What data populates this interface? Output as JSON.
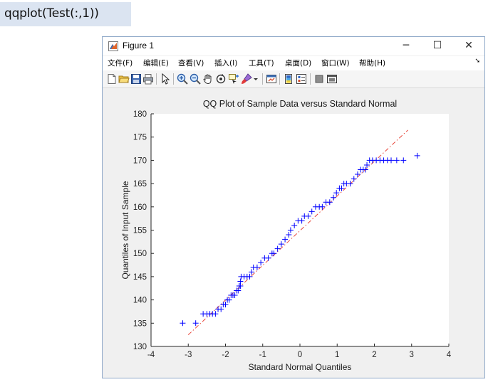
{
  "command": {
    "text": "qqplot(Test(:,1))"
  },
  "window": {
    "title": "Figure 1",
    "controls": {
      "minimize": "─",
      "maximize": "☐",
      "close": "✕"
    }
  },
  "menu": {
    "items": [
      "文件(F)",
      "编辑(E)",
      "查看(V)",
      "插入(I)",
      "工具(T)",
      "桌面(D)",
      "窗口(W)",
      "帮助(H)"
    ],
    "overflow_arrow": "➘"
  },
  "toolbar": {
    "icons": [
      "new-figure-icon",
      "open-file-icon",
      "save-icon",
      "print-icon",
      "edit-plot-arrow-icon",
      "zoom-in-icon",
      "zoom-out-icon",
      "pan-hand-icon",
      "rotate-3d-icon",
      "data-cursor-icon",
      "brush-icon",
      "dropdown-arrow-icon",
      "link-plot-icon",
      "insert-colorbar-icon",
      "insert-legend-icon",
      "hide-plot-tools-icon",
      "show-plot-tools-icon"
    ]
  },
  "chart_data": {
    "type": "scatter",
    "title": "QQ Plot of Sample Data versus Standard Normal",
    "xlabel": "Standard Normal Quantiles",
    "ylabel": "Quantiles of Input Sample",
    "xlim": [
      -4,
      4
    ],
    "ylim": [
      130,
      180
    ],
    "xticks": [
      "-4",
      "-3",
      "-2",
      "-1",
      "0",
      "1",
      "2",
      "3",
      "4"
    ],
    "yticks": [
      "130",
      "135",
      "140",
      "145",
      "150",
      "155",
      "160",
      "165",
      "170",
      "175",
      "180"
    ],
    "grid": false,
    "colors": {
      "marker": "#0000ff",
      "reference_line": "#e8473b"
    },
    "reference_line": {
      "x": [
        -3.0,
        2.9
      ],
      "y": [
        132.5,
        176.5
      ]
    },
    "series": [
      {
        "marker": "+",
        "points": [
          [
            -3.15,
            135
          ],
          [
            -2.8,
            135
          ],
          [
            -2.6,
            137
          ],
          [
            -2.5,
            137
          ],
          [
            -2.42,
            137
          ],
          [
            -2.35,
            137
          ],
          [
            -2.27,
            137
          ],
          [
            -2.2,
            138
          ],
          [
            -2.12,
            138
          ],
          [
            -2.06,
            139
          ],
          [
            -2.0,
            139
          ],
          [
            -1.95,
            140
          ],
          [
            -1.9,
            140
          ],
          [
            -1.85,
            141
          ],
          [
            -1.8,
            141
          ],
          [
            -1.75,
            141
          ],
          [
            -1.7,
            142
          ],
          [
            -1.66,
            142
          ],
          [
            -1.63,
            143
          ],
          [
            -1.6,
            143
          ],
          [
            -1.6,
            144
          ],
          [
            -1.58,
            145
          ],
          [
            -1.5,
            145
          ],
          [
            -1.42,
            145
          ],
          [
            -1.35,
            145
          ],
          [
            -1.3,
            146
          ],
          [
            -1.25,
            147
          ],
          [
            -1.15,
            147
          ],
          [
            -1.05,
            148
          ],
          [
            -0.95,
            149
          ],
          [
            -0.85,
            149
          ],
          [
            -0.75,
            150
          ],
          [
            -0.7,
            150
          ],
          [
            -0.6,
            151
          ],
          [
            -0.5,
            152
          ],
          [
            -0.4,
            153
          ],
          [
            -0.3,
            154
          ],
          [
            -0.25,
            155
          ],
          [
            -0.15,
            156
          ],
          [
            -0.05,
            157
          ],
          [
            0.05,
            157
          ],
          [
            0.12,
            158
          ],
          [
            0.22,
            158
          ],
          [
            0.32,
            159
          ],
          [
            0.42,
            160
          ],
          [
            0.52,
            160
          ],
          [
            0.6,
            160
          ],
          [
            0.7,
            161
          ],
          [
            0.8,
            161
          ],
          [
            0.9,
            162
          ],
          [
            0.98,
            163
          ],
          [
            1.06,
            164
          ],
          [
            1.12,
            164
          ],
          [
            1.18,
            165
          ],
          [
            1.25,
            165
          ],
          [
            1.35,
            165
          ],
          [
            1.45,
            166
          ],
          [
            1.55,
            167
          ],
          [
            1.63,
            168
          ],
          [
            1.7,
            168
          ],
          [
            1.76,
            168
          ],
          [
            1.8,
            169
          ],
          [
            1.87,
            170
          ],
          [
            1.95,
            170
          ],
          [
            2.05,
            170
          ],
          [
            2.15,
            170
          ],
          [
            2.25,
            170
          ],
          [
            2.35,
            170
          ],
          [
            2.45,
            170
          ],
          [
            2.6,
            170
          ],
          [
            2.78,
            170
          ],
          [
            3.15,
            171
          ]
        ]
      }
    ]
  }
}
